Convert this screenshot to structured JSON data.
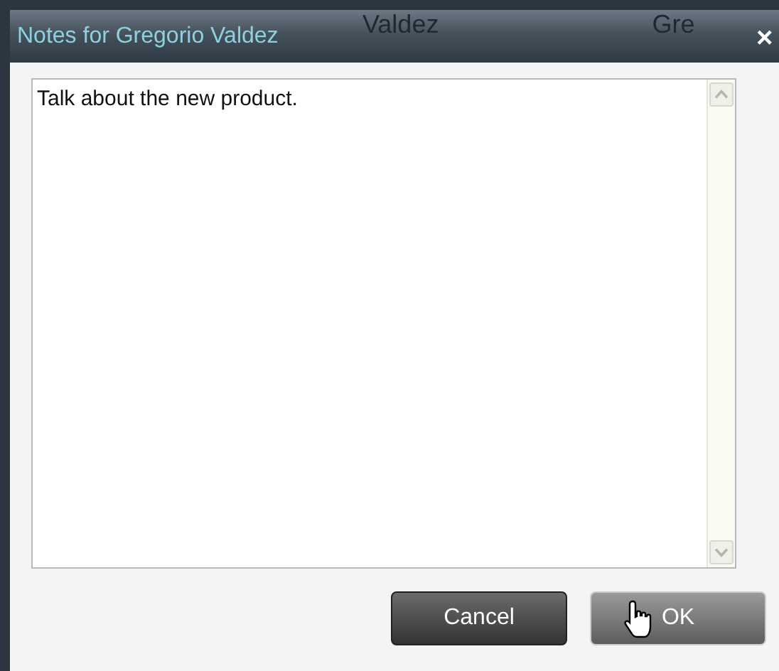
{
  "background_window": {
    "texts": [
      "Valdez",
      "Gre"
    ]
  },
  "dialog": {
    "title": "Notes for Gregorio Valdez",
    "close": "×"
  },
  "notes": {
    "value": "Talk about the new product."
  },
  "buttons": [
    {
      "label": "Cancel",
      "kind": "cancel",
      "hovered": false
    },
    {
      "label": "OK",
      "kind": "ok",
      "hovered": true
    }
  ]
}
